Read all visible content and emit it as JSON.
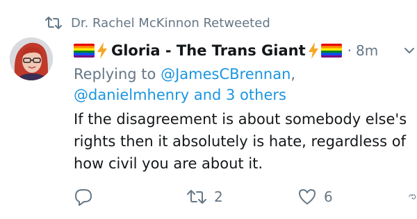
{
  "retweet_banner": {
    "text": "Dr. Rachel McKinnon Retweeted"
  },
  "tweet": {
    "author_name": "Gloria - The Trans Giant",
    "timestamp": "8m",
    "separator": "·",
    "reply_prefix": "Replying to ",
    "reply_mention_1": "@JamesCBrennan",
    "reply_comma": ",",
    "reply_mention_2": "@danielmhenry",
    "reply_and": " and ",
    "reply_others": "3 others",
    "text_lines": [
      "If the disagreement is about somebody else's",
      "rights then it absolutely is hate, regardless of",
      "how civil you are about it."
    ]
  },
  "actions": {
    "reply_count": "",
    "retweet_count": "2",
    "like_count": "6"
  },
  "icons": {
    "retweet_banner": "retweet-icon",
    "reply": "reply-icon",
    "retweet": "retweet-icon",
    "like": "heart-icon",
    "share": "share-icon",
    "menu": "chevron-down-icon",
    "emoji_flag": "rainbow-flag-icon",
    "emoji_bolt": "lightning-icon"
  },
  "colors": {
    "secondary_text": "#657786",
    "link": "#1b95e0",
    "primary_text": "#14171a",
    "bolt": "#f5a623"
  }
}
